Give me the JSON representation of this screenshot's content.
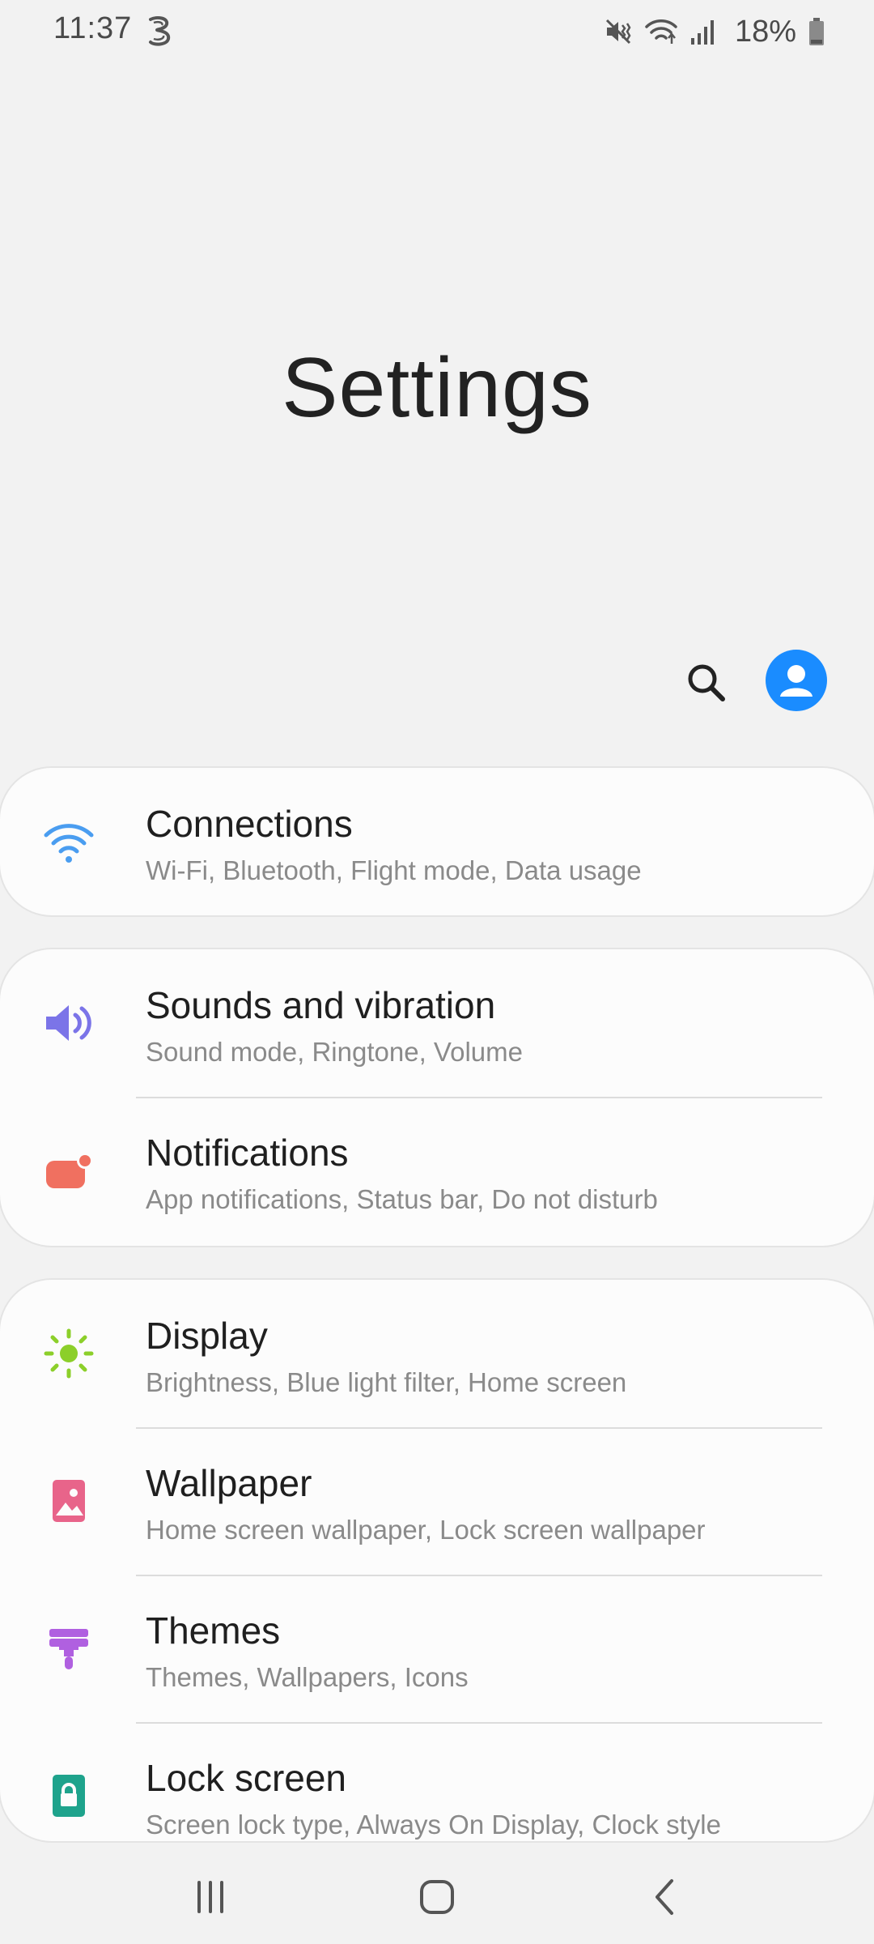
{
  "status_bar": {
    "time": "11:37",
    "carrier_icon": "three-network-icon",
    "icons": [
      "mute-vibrate-icon",
      "wifi-icon",
      "signal-icon",
      "battery-icon"
    ],
    "battery_percent": "18%"
  },
  "header": {
    "title": "Settings",
    "search_icon": "search-icon",
    "profile_icon": "profile-avatar-icon"
  },
  "colors": {
    "accent_blue": "#1a8cff",
    "connections_icon": "#4a9df0",
    "sounds_icon": "#7b74e8",
    "notifications_icon": "#f07060",
    "display_icon": "#8ccf2a",
    "wallpaper_icon": "#e8648a",
    "themes_icon": "#b060e0",
    "lockscreen_icon": "#1ea38c"
  },
  "groups": [
    {
      "items": [
        {
          "title": "Connections",
          "subtitle": "Wi-Fi, Bluetooth, Flight mode, Data usage",
          "icon": "wifi-icon"
        }
      ]
    },
    {
      "items": [
        {
          "title": "Sounds and vibration",
          "subtitle": "Sound mode, Ringtone, Volume",
          "icon": "speaker-icon"
        },
        {
          "title": "Notifications",
          "subtitle": "App notifications, Status bar, Do not disturb",
          "icon": "notification-badge-icon"
        }
      ]
    },
    {
      "items": [
        {
          "title": "Display",
          "subtitle": "Brightness, Blue light filter, Home screen",
          "icon": "sun-icon"
        },
        {
          "title": "Wallpaper",
          "subtitle": "Home screen wallpaper, Lock screen wallpaper",
          "icon": "picture-icon"
        },
        {
          "title": "Themes",
          "subtitle": "Themes, Wallpapers, Icons",
          "icon": "paintbrush-icon"
        },
        {
          "title": "Lock screen",
          "subtitle": "Screen lock type, Always On Display, Clock style",
          "icon": "lock-icon"
        }
      ]
    }
  ],
  "nav_bar": {
    "recent_icon": "recent-apps-icon",
    "home_icon": "home-icon",
    "back_icon": "back-icon"
  }
}
